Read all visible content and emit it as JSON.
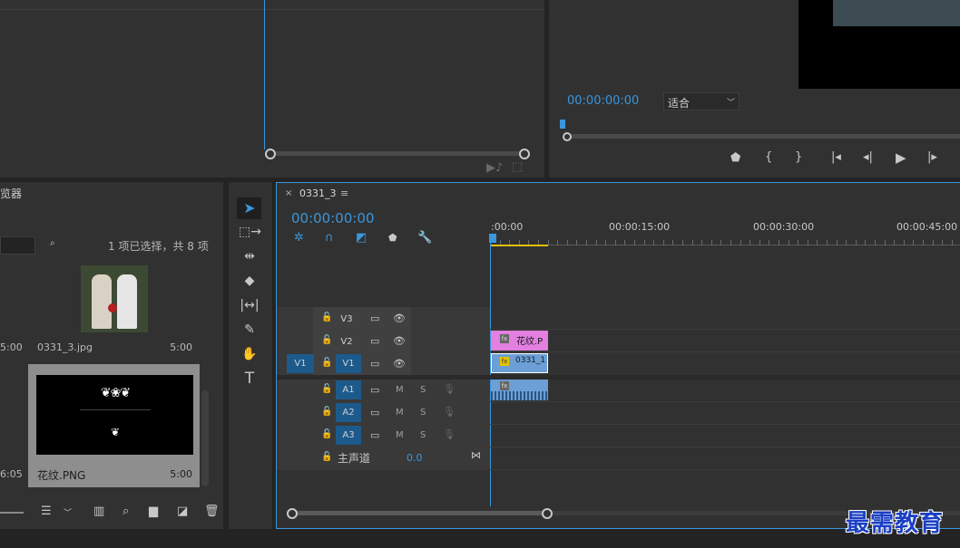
{
  "program_monitor": {
    "timecode": "00:00:00:00",
    "fit_label": "适合"
  },
  "project_panel": {
    "title_fragment": "览器",
    "selection_status": "1 项已选择，共 8 项",
    "items": [
      {
        "name": "0331_3.jpg",
        "duration": "5:00"
      },
      {
        "name": "花纹.PNG",
        "duration": "5:00"
      }
    ],
    "left_durations": [
      "5:00",
      "6:05"
    ]
  },
  "timeline": {
    "tab_label": "0331_3",
    "timecode": "00:00:00:00",
    "ruler": [
      ":00:00",
      "00:00:15:00",
      "00:00:30:00",
      "00:00:45:00"
    ],
    "video_tracks": [
      "V3",
      "V2",
      "V1"
    ],
    "audio_tracks": [
      "A1",
      "A2",
      "A3"
    ],
    "source_patch": "V1",
    "master_label": "主声道",
    "master_value": "0.0",
    "clips": {
      "v2": {
        "name": "花纹.P",
        "fx": "fx",
        "color": "#e27fe1"
      },
      "v1": {
        "name": "0331_1",
        "fx": "fx",
        "color": "#6b9fd6"
      }
    },
    "audio_letters": {
      "mute": "M",
      "solo": "S"
    }
  },
  "watermark": "最需教育"
}
